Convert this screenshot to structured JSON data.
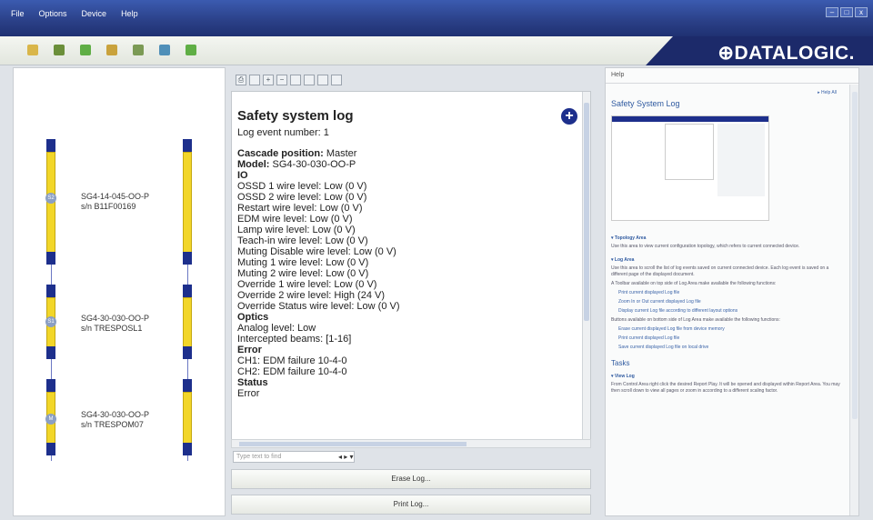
{
  "menu": [
    "File",
    "Options",
    "Device",
    "Help"
  ],
  "brand": "⊕DATALOGIC.",
  "topology": {
    "devices": [
      {
        "model": "SG4-14-045-OO-P",
        "serial": "s/n B11F00169",
        "badge": "S2"
      },
      {
        "model": "SG4-30-030-OO-P",
        "serial": "s/n TRESPOSL1",
        "badge": "S1"
      },
      {
        "model": "SG4-30-030-OO-P",
        "serial": "s/n TRESPOM07",
        "badge": "M"
      }
    ]
  },
  "log": {
    "title": "Safety system log",
    "event": "Log event number: 1",
    "cascade_label": "Cascade position:",
    "cascade_value": "Master",
    "model_label": "Model:",
    "model_value": "SG4-30-030-OO-P",
    "io_head": "IO",
    "io_lines": [
      "OSSD 1 wire level: Low (0 V)",
      "OSSD 2 wire level: Low (0 V)",
      "Restart wire level: Low (0 V)",
      "EDM wire level: Low (0 V)",
      "Lamp wire level: Low (0 V)",
      "Teach-in wire level: Low (0 V)",
      "Muting Disable wire level: Low (0 V)",
      "Muting 1 wire level: Low (0 V)",
      "Muting 2 wire level: Low (0 V)",
      "Override 1 wire level: Low (0 V)",
      "Override 2 wire level: High (24 V)",
      "Override Status wire level: Low (0 V)"
    ],
    "optics_head": "Optics",
    "optics_lines": [
      "Analog level: Low",
      "Intercepted beams: [1-16]"
    ],
    "error_head": "Error",
    "error_lines": [
      "CH1: EDM failure 10-4-0",
      "CH2: EDM failure 10-4-0"
    ],
    "status_head": "Status",
    "status_value": "Error",
    "find_placeholder": "Type text to find",
    "find_nav": "◂ ▸ ▾"
  },
  "buttons": {
    "erase": "Erase Log...",
    "print": "Print Log..."
  },
  "help": {
    "tab": "Help",
    "link": "▸ Help All",
    "title": "Safety System Log",
    "sections": [
      {
        "head": "▾ Topology Area",
        "text": "Use this area to view current configuration topology, which refers to current connected device."
      },
      {
        "head": "▾ Log Area",
        "text": "Use this area to scroll the list of log events saved on current connected device. Each log event is saved on a different page of the displayed document."
      }
    ],
    "toolbar_intro": "A Toolbar available on top side of Log Area make available the following functions:",
    "toolbar_items": [
      "Print current displayed Log file",
      "Zoom In or Out current displayed Log file",
      "Display current Log file according to different layout options"
    ],
    "buttons_intro": "Buttons available on bottom side of Log Area make available the following functions:",
    "buttons_items": [
      "Erase current displayed Log file from device memory",
      "Print current displayed Log file",
      "Save current displayed Log file on local drive"
    ],
    "tasks": "Tasks",
    "view_head": "▾ View Log",
    "view_text": "From Control Area right click the desired Report Play. It will be opened and displayed within Report Area. You may then scroll down to view all pages or zoom in according to a different scaling factor."
  },
  "colors": {
    "accent": "#1d2f8c",
    "device_yellow": "#f2d629",
    "titlebar": "#2a3f86"
  }
}
